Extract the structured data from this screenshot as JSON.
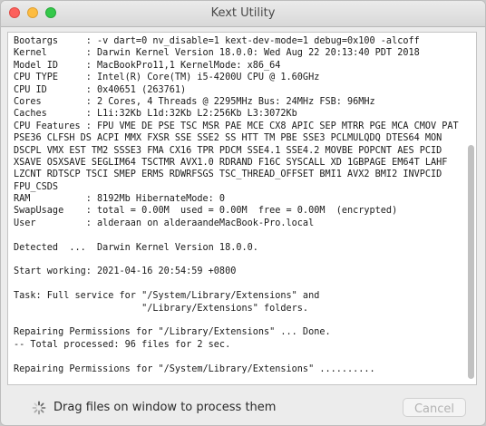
{
  "window": {
    "title": "Kext Utility"
  },
  "log": {
    "lines": [
      "Bootargs     : -v dart=0 nv_disable=1 kext-dev-mode=1 debug=0x100 -alcoff",
      "Kernel       : Darwin Kernel Version 18.0.0: Wed Aug 22 20:13:40 PDT 2018",
      "Model ID     : MacBookPro11,1 KernelMode: x86_64",
      "CPU TYPE     : Intel(R) Core(TM) i5-4200U CPU @ 1.60GHz",
      "CPU ID       : 0x40651 (263761)",
      "Cores        : 2 Cores, 4 Threads @ 2295MHz Bus: 24MHz FSB: 96MHz",
      "Caches       : L1i:32Kb L1d:32Kb L2:256Kb L3:3072Kb",
      "CPU Features : FPU VME DE PSE TSC MSR PAE MCE CX8 APIC SEP MTRR PGE MCA CMOV PAT",
      "PSE36 CLFSH DS ACPI MMX FXSR SSE SSE2 SS HTT TM PBE SSE3 PCLMULQDQ DTES64 MON",
      "DSCPL VMX EST TM2 SSSE3 FMA CX16 TPR PDCM SSE4.1 SSE4.2 MOVBE POPCNT AES PCID",
      "XSAVE OSXSAVE SEGLIM64 TSCTMR AVX1.0 RDRAND F16C SYSCALL XD 1GBPAGE EM64T LAHF",
      "LZCNT RDTSCP TSCI SMEP ERMS RDWRFSGS TSC_THREAD_OFFSET BMI1 AVX2 BMI2 INVPCID",
      "FPU_CSDS",
      "RAM          : 8192Mb HibernateMode: 0",
      "SwapUsage    : total = 0.00M  used = 0.00M  free = 0.00M  (encrypted)",
      "User         : alderaan on alderaandeMacBook-Pro.local",
      "",
      "Detected  ...  Darwin Kernel Version 18.0.0.",
      "",
      "Start working: 2021-04-16 20:54:59 +0800",
      "",
      "Task: Full service for \"/System/Library/Extensions\" and",
      "                       \"/Library/Extensions\" folders.",
      "",
      "Repairing Permissions for \"/Library/Extensions\" ... Done.",
      "-- Total processed: 96 files for 2 sec.",
      "",
      "Repairing Permissions for \"/System/Library/Extensions\" .........."
    ]
  },
  "footer": {
    "status_text": "Drag files on window to process them",
    "cancel_label": "Cancel"
  },
  "colors": {
    "close": "#fc605c",
    "minimize": "#fdbc40",
    "zoom": "#34c84a"
  },
  "icons": {
    "spinner": "spinner-icon"
  }
}
